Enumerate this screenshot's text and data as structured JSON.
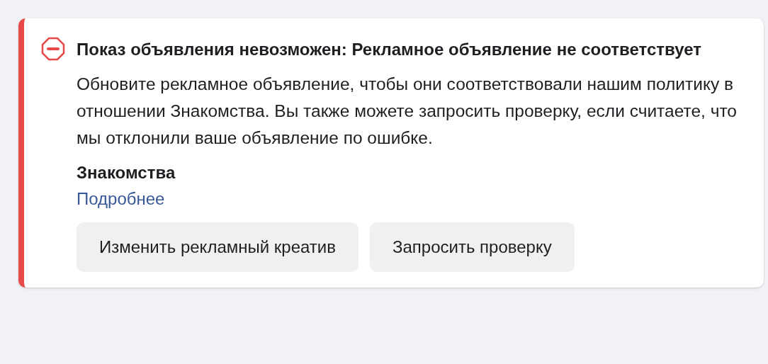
{
  "alert": {
    "title": "Показ объявления невозможен: Рекламное объявление не соответствует",
    "message": "Обновите рекламное объявление, чтобы они соответствовали нашим политику в отношении Знакомства. Вы также можете запросить проверку, если считаете, что мы отклонили ваше объявление по ошибке.",
    "policy": "Знакомства",
    "link": "Подробнее",
    "buttons": [
      "Изменить рекламный креатив",
      "Запросить проверку"
    ]
  }
}
